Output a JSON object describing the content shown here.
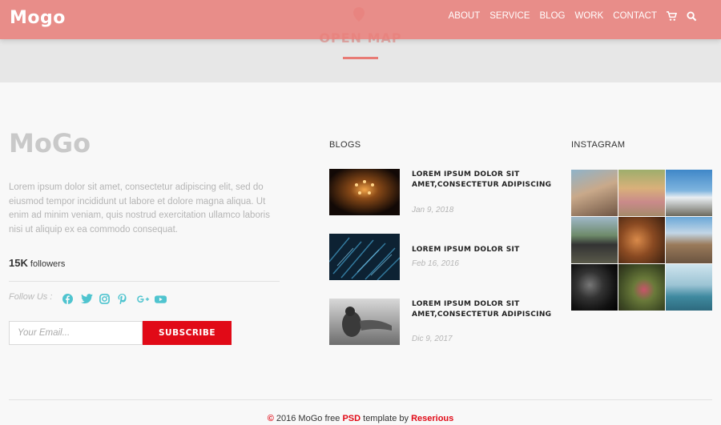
{
  "nav": {
    "logo": "Mogo",
    "items": [
      "ABOUT",
      "SERVICE",
      "BLOG",
      "WORK",
      "CONTACT"
    ]
  },
  "map": {
    "label": "OPEN MAP"
  },
  "about": {
    "brand": "MoGo",
    "text": "Lorem ipsum dolor sit amet, consectetur adipiscing elit, sed do eiusmod tempor incididunt ut labore et dolore magna aliqua. Ut enim ad minim veniam, quis nostrud exercitation ullamco laboris nisi ut aliquip ex ea commodo consequat.",
    "followers_count": "15K",
    "followers_label": "followers",
    "follow_label": "Follow Us :",
    "social": [
      "facebook-icon",
      "twitter-icon",
      "instagram-icon",
      "pinterest-icon",
      "google-plus-icon",
      "youtube-icon"
    ]
  },
  "subscribe": {
    "placeholder": "Your Email...",
    "button": "SUBSCRIBE"
  },
  "blogs": {
    "title": "BLOGS",
    "posts": [
      {
        "title": "LOREM IPSUM DOLOR SIT AMET,CONSECTETUR ADIPISCING",
        "date": "Jan 9, 2018"
      },
      {
        "title": "LOREM IPSUM DOLOR SIT",
        "date": "Feb 16, 2016"
      },
      {
        "title": "LOREM IPSUM DOLOR SIT AMET,CONSECTETUR ADIPISCING",
        "date": "Dic 9, 2017"
      }
    ]
  },
  "instagram": {
    "title": "INSTAGRAM"
  },
  "footer": {
    "symbol": "©",
    "pre": " 2016 MoGo free ",
    "psd": "PSD",
    "mid": " template by ",
    "author": "Reserious"
  },
  "colors": {
    "accent": "#e87b75",
    "red": "#e10a17",
    "teal": "#4fc4cf"
  }
}
